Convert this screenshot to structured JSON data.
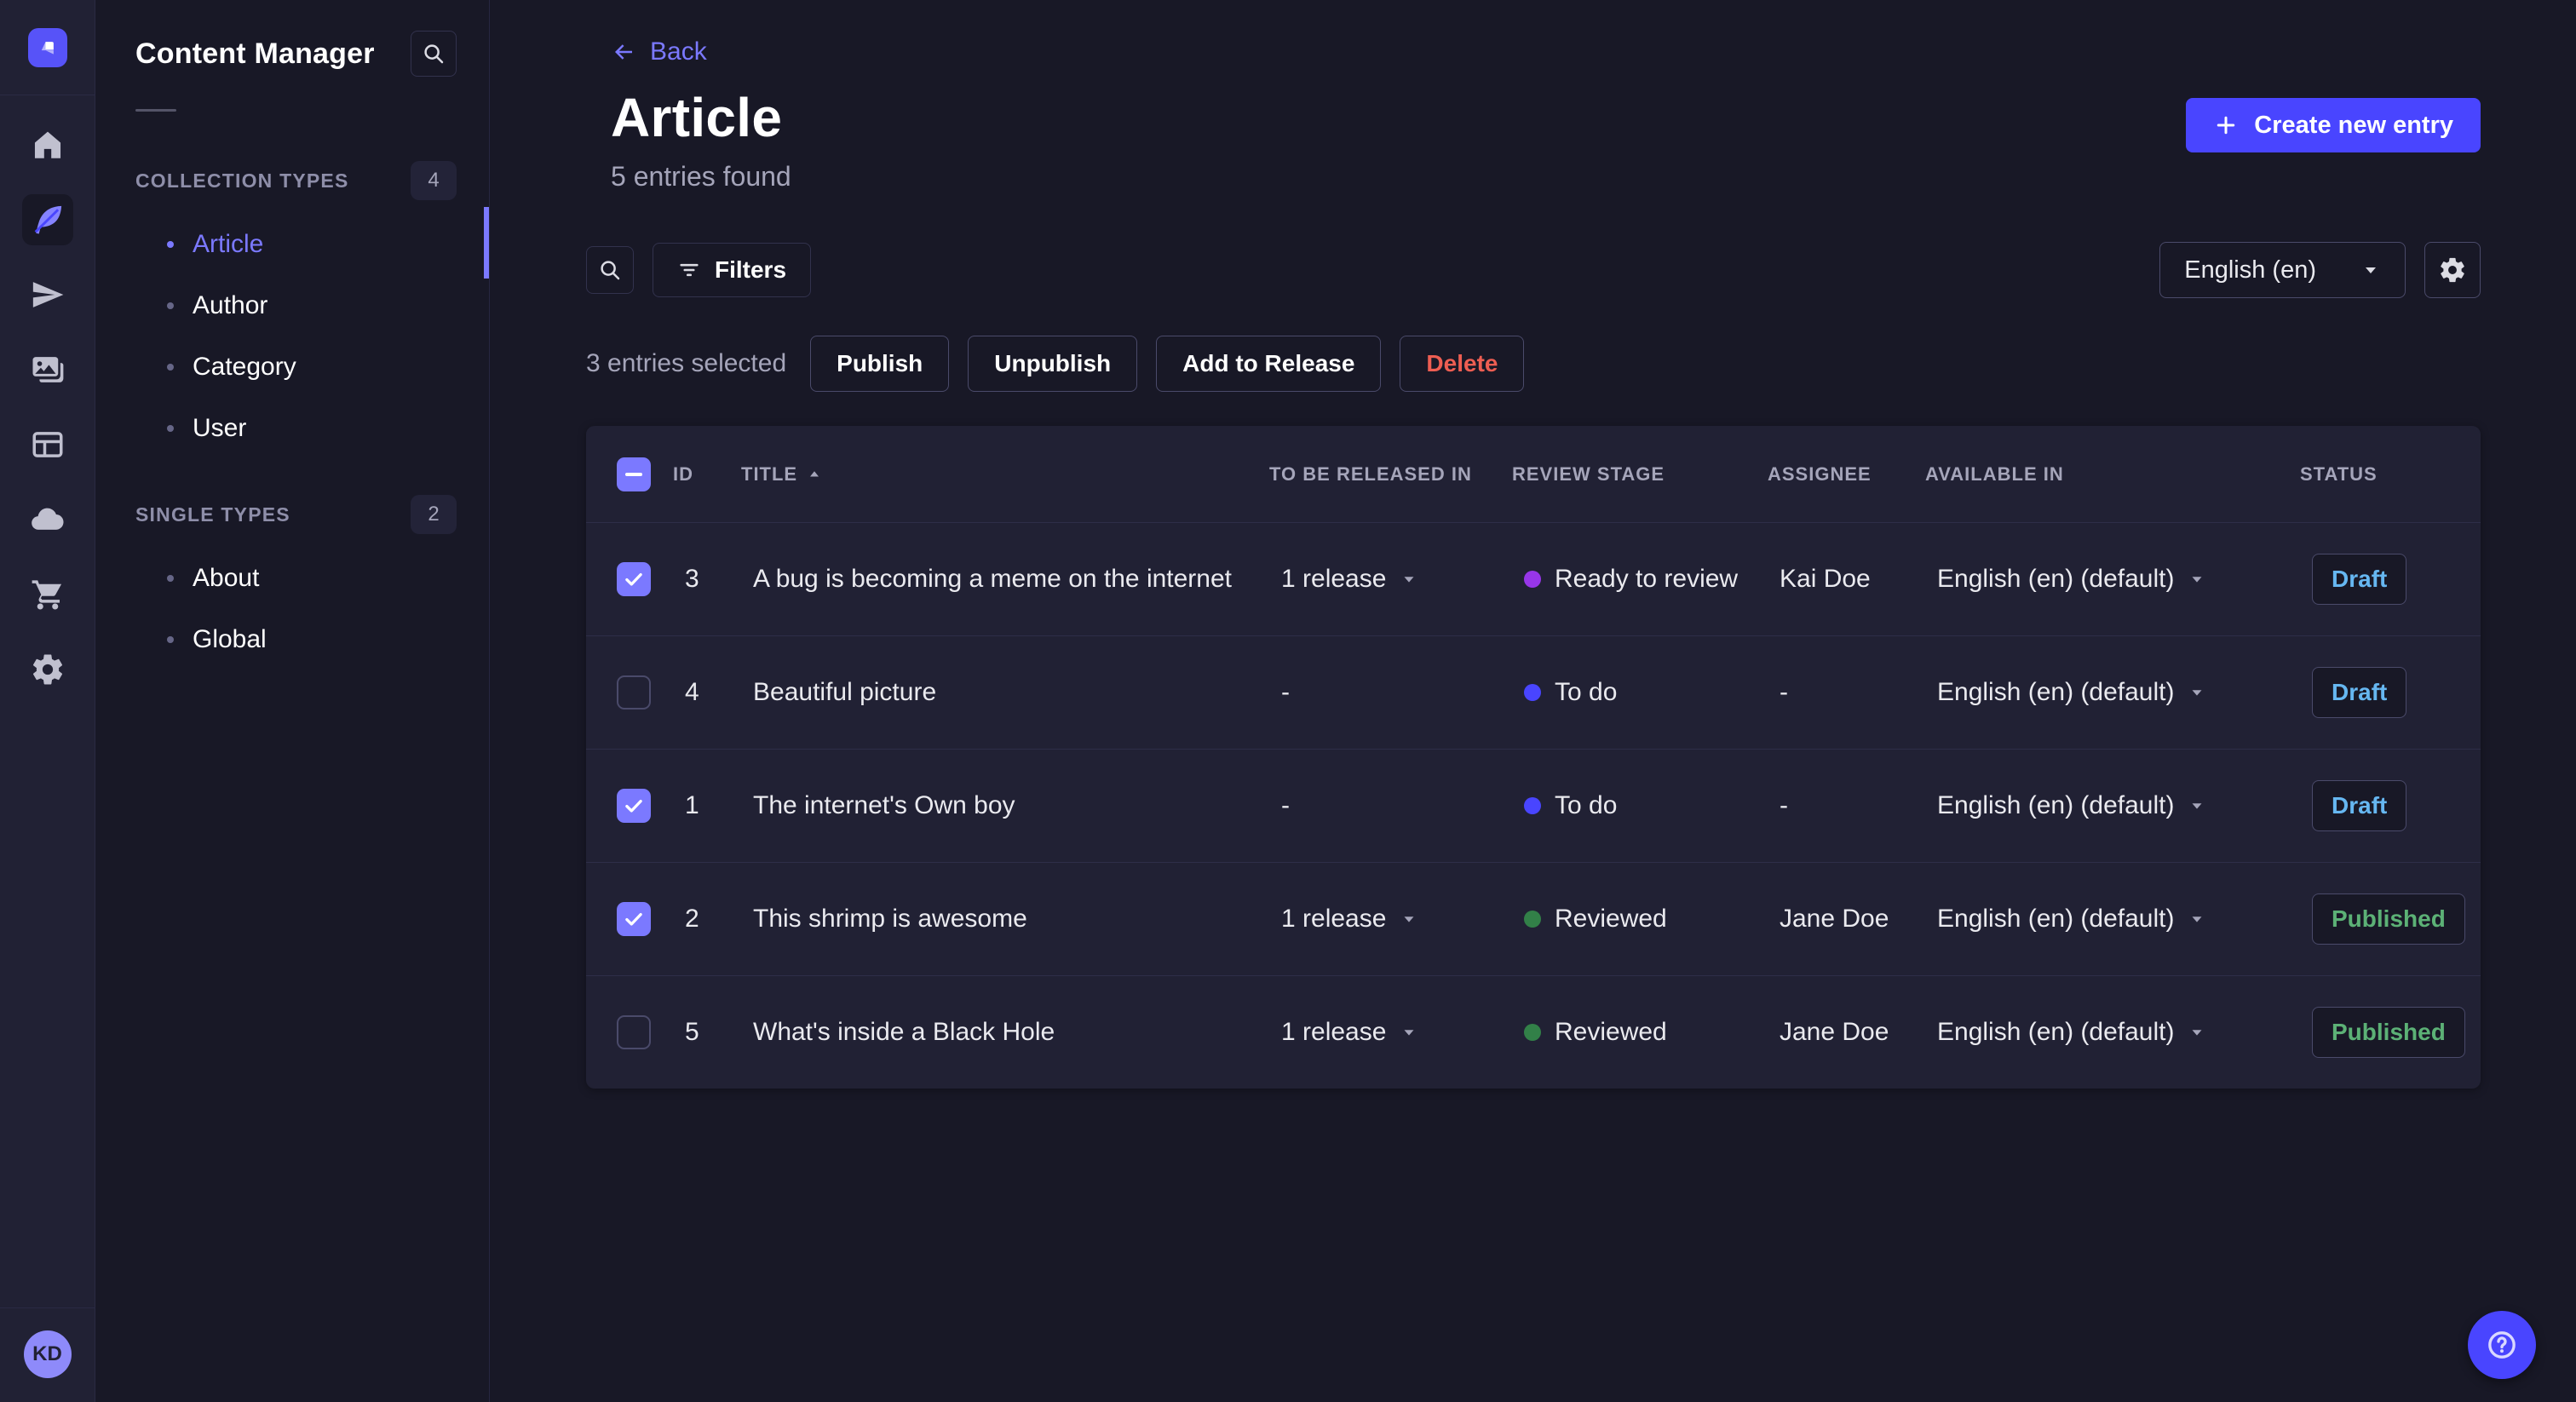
{
  "colors": {
    "accent": "#4945ff",
    "accent_light": "#7b79ff",
    "draft": "#66b7f1",
    "published": "#5cb176",
    "danger": "#ee5e52",
    "review_todo": "#4945ff",
    "review_ready": "#9736e8",
    "review_reviewed": "#328048"
  },
  "sidebar": {
    "rail": {
      "logo_icon": "strapi-logo-icon",
      "icons": [
        {
          "name": "home-icon",
          "glyph": "home",
          "active": false
        },
        {
          "name": "content-manager-feather-icon",
          "glyph": "feather",
          "active": true
        },
        {
          "name": "releases-paper-plane-icon",
          "glyph": "plane",
          "active": false
        },
        {
          "name": "media-library-images-icon",
          "glyph": "images",
          "active": false
        },
        {
          "name": "content-type-builder-layout-icon",
          "glyph": "layout",
          "active": false
        },
        {
          "name": "deploy-cloud-icon",
          "glyph": "cloud",
          "active": false
        },
        {
          "name": "marketplace-cart-icon",
          "glyph": "cart",
          "active": false
        },
        {
          "name": "settings-gear-icon",
          "glyph": "gear",
          "active": false
        }
      ],
      "avatar_initials": "KD"
    },
    "panel": {
      "title": "Content Manager",
      "search_icon": "search-icon",
      "sections": [
        {
          "label": "COLLECTION TYPES",
          "count": "4",
          "items": [
            {
              "label": "Article",
              "active": true
            },
            {
              "label": "Author",
              "active": false
            },
            {
              "label": "Category",
              "active": false
            },
            {
              "label": "User",
              "active": false
            }
          ]
        },
        {
          "label": "SINGLE TYPES",
          "count": "2",
          "items": [
            {
              "label": "About",
              "active": false
            },
            {
              "label": "Global",
              "active": false
            }
          ]
        }
      ]
    }
  },
  "header": {
    "back_label": "Back",
    "title": "Article",
    "subtitle": "5 entries found",
    "create_label": "Create new entry"
  },
  "toolbar": {
    "filters_label": "Filters",
    "locale_value": "English (en)"
  },
  "selection": {
    "text": "3 entries selected",
    "actions": [
      {
        "label": "Publish",
        "style": "default"
      },
      {
        "label": "Unpublish",
        "style": "default"
      },
      {
        "label": "Add to Release",
        "style": "default"
      },
      {
        "label": "Delete",
        "style": "danger"
      }
    ]
  },
  "table": {
    "select_all_state": "indeterminate",
    "sorted": {
      "column": "TITLE",
      "direction": "asc"
    },
    "headers": [
      "ID",
      "TITLE",
      "TO BE RELEASED IN",
      "REVIEW STAGE",
      "ASSIGNEE",
      "AVAILABLE IN",
      "STATUS"
    ],
    "rows": [
      {
        "checked": true,
        "id": "3",
        "title": "A bug is becoming a meme on the internet",
        "release": "1 release",
        "review_stage": "Ready to review",
        "review_color": "#9736e8",
        "assignee": "Kai Doe",
        "available": "English (en) (default)",
        "status": "Draft"
      },
      {
        "checked": false,
        "id": "4",
        "title": "Beautiful picture",
        "release": "-",
        "review_stage": "To do",
        "review_color": "#4945ff",
        "assignee": "-",
        "available": "English (en) (default)",
        "status": "Draft"
      },
      {
        "checked": true,
        "id": "1",
        "title": "The internet's Own boy",
        "release": "-",
        "review_stage": "To do",
        "review_color": "#4945ff",
        "assignee": "-",
        "available": "English (en) (default)",
        "status": "Draft"
      },
      {
        "checked": true,
        "id": "2",
        "title": "This shrimp is awesome",
        "release": "1 release",
        "review_stage": "Reviewed",
        "review_color": "#328048",
        "assignee": "Jane Doe",
        "available": "English (en) (default)",
        "status": "Published"
      },
      {
        "checked": false,
        "id": "5",
        "title": "What's inside a Black Hole",
        "release": "1 release",
        "review_stage": "Reviewed",
        "review_color": "#328048",
        "assignee": "Jane Doe",
        "available": "English (en) (default)",
        "status": "Published"
      }
    ]
  },
  "help": {
    "icon": "question-mark-icon"
  }
}
